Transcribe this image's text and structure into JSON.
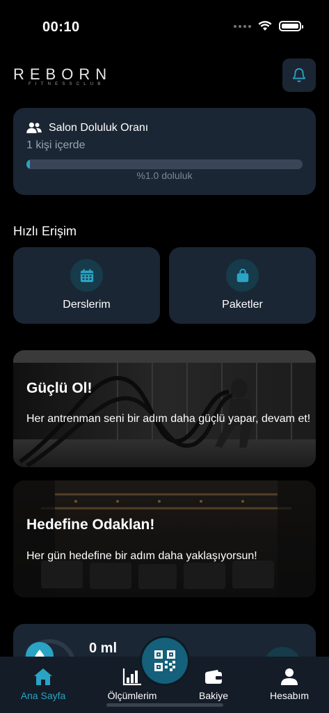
{
  "status_bar": {
    "time": "00:10"
  },
  "header": {
    "logo_main": "REBORN",
    "logo_sub": "FITNESSCLUB"
  },
  "occupancy": {
    "title": "Salon Doluluk Oranı",
    "count_text": "1 kişi içerde",
    "percent_text": "%1.0 doluluk",
    "percent_value": 1.0
  },
  "quick_access": {
    "title": "Hızlı Erişim",
    "items": [
      {
        "label": "Derslerim",
        "icon": "calendar-icon"
      },
      {
        "label": "Paketler",
        "icon": "bag-icon"
      }
    ]
  },
  "banners": [
    {
      "title": "Güçlü Ol!",
      "text": "Her antrenman seni bir adım daha güçlü yapar, devam et!"
    },
    {
      "title": "Hedefine Odaklan!",
      "text": "Her gün hedefine bir adım daha yaklaşıyorsun!"
    }
  ],
  "water": {
    "amount": "0 ml"
  },
  "bottom_nav": {
    "items": [
      {
        "label": "Ana Sayfa",
        "icon": "home-icon",
        "active": true
      },
      {
        "label": "Ölçümlerim",
        "icon": "bar-chart-icon",
        "active": false
      },
      {
        "label": "Bakiye",
        "icon": "wallet-icon",
        "active": false
      },
      {
        "label": "Hesabım",
        "icon": "person-icon",
        "active": false
      }
    ],
    "center_button_icon": "qr-code-icon"
  },
  "colors": {
    "accent": "#2aa3c4",
    "card": "#1b2634",
    "background": "#000000",
    "nav": "#141c27"
  }
}
